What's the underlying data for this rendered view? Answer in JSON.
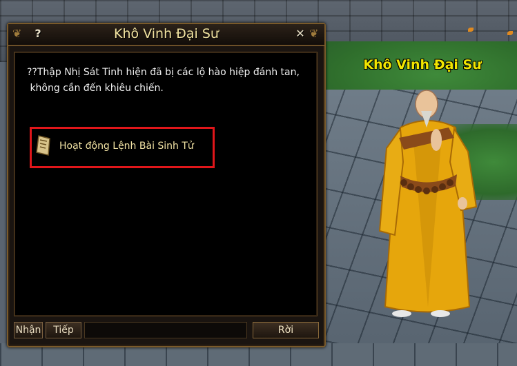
{
  "npc": {
    "name": "Khô Vinh Đại Sư"
  },
  "dialog": {
    "title": "Khô Vinh Đại Sư",
    "help_label": "?",
    "close_label": "✕",
    "message": "??Thập Nhị Sát Tinh hiện đã bị các lộ hào hiệp đánh tan,\n không cần đến khiêu chiến.",
    "option": {
      "label": "Hoạt động Lệnh Bài Sinh Tử",
      "icon": "token-scroll-icon"
    },
    "buttons": {
      "accept": "Nhận",
      "next": "Tiếp",
      "leave": "Rời"
    }
  },
  "colors": {
    "npc_name": "#f2e700",
    "option_highlight": "#e0161a",
    "option_text": "#f2e3a4",
    "title_text": "#f1e2a0"
  }
}
